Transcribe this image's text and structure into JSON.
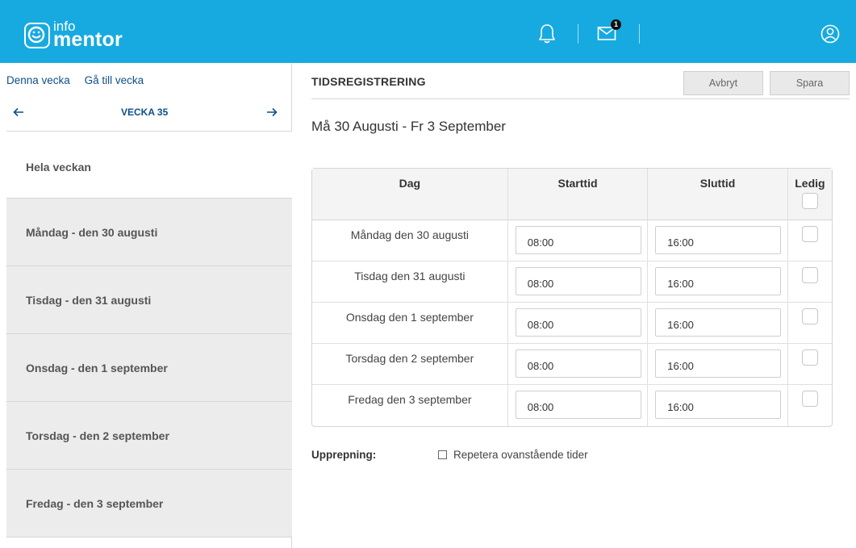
{
  "header": {
    "logo_top": "info",
    "logo_bottom": "mentor",
    "mail_badge": "1",
    "icons": {
      "notifications": "bell-icon",
      "messages": "mail-icon",
      "account": "user-circle-icon"
    },
    "background_color": "#17aae0"
  },
  "sidebar": {
    "links": {
      "current_week": "Denna vecka",
      "go_to_week": "Gå till vecka"
    },
    "week_nav": {
      "prev": "←",
      "label": "VECKA 35",
      "next": "→"
    },
    "items": [
      {
        "label": "Hela veckan"
      },
      {
        "label": "Måndag - den 30 augusti"
      },
      {
        "label": "Tisdag - den 31 augusti"
      },
      {
        "label": "Onsdag - den 1 september"
      },
      {
        "label": "Torsdag - den 2 september"
      },
      {
        "label": "Fredag - den 3 september"
      }
    ]
  },
  "main": {
    "title": "TIDSREGISTRERING",
    "buttons": {
      "cancel": "Avbryt",
      "save": "Spara"
    },
    "date_range": "Må 30 Augusti - Fr 3 September",
    "table": {
      "headers": {
        "day": "Dag",
        "start": "Starttid",
        "end": "Sluttid",
        "free": "Ledig"
      },
      "rows": [
        {
          "day": "Måndag den 30 augusti",
          "start": "08:00",
          "end": "16:00"
        },
        {
          "day": "Tisdag den 31 augusti",
          "start": "08:00",
          "end": "16:00"
        },
        {
          "day": "Onsdag den 1 september",
          "start": "08:00",
          "end": "16:00"
        },
        {
          "day": "Torsdag den 2 september",
          "start": "08:00",
          "end": "16:00"
        },
        {
          "day": "Fredag den 3 september",
          "start": "08:00",
          "end": "16:00"
        }
      ]
    },
    "repeat": {
      "label": "Upprepning:",
      "option": "Repetera ovanstående tider"
    }
  }
}
